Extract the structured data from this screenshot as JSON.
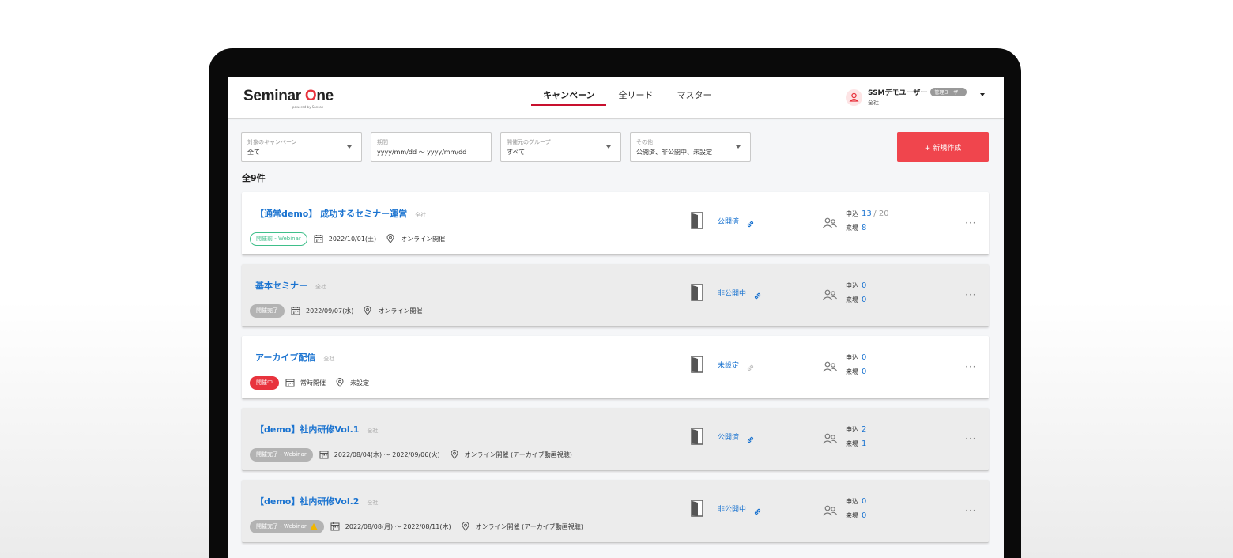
{
  "header": {
    "logo_main": "Seminar ",
    "logo_accent": "O",
    "logo_rest": "ne",
    "logo_sub": "powered by Sansan",
    "nav": [
      {
        "label": "キャンペーン",
        "active": true
      },
      {
        "label": "全リード",
        "active": false
      },
      {
        "label": "マスター",
        "active": false
      }
    ],
    "user": {
      "name": "SSMデモユーザー",
      "role": "管理ユーザー",
      "company": "全社"
    }
  },
  "filters": [
    {
      "label": "対象のキャンペーン",
      "value": "全て",
      "has_dropdown": true
    },
    {
      "label": "期間",
      "value": "yyyy/mm/dd 〜 yyyy/mm/dd",
      "has_dropdown": false
    },
    {
      "label": "開催元のグループ",
      "value": "すべて",
      "has_dropdown": true
    },
    {
      "label": "その他",
      "value": "公開済、非公開中、未設定",
      "has_dropdown": true
    }
  ],
  "create_button": "+ 新規作成",
  "total": "全9件",
  "campaigns": [
    {
      "title": "【通常demo】 成功するセミナー運営",
      "tag": "全社",
      "status": "開催前 - Webinar",
      "status_style": "green",
      "warning": false,
      "date": "2022/10/01(土)",
      "location": "オンライン開催",
      "publish": "公開済",
      "link_active": true,
      "applied_label": "申込",
      "applied": "13",
      "capacity": "/ 20",
      "attended_label": "来場",
      "attended": "8",
      "bg": "white"
    },
    {
      "title": "基本セミナー",
      "tag": "全社",
      "status": "開催完了",
      "status_style": "grayb",
      "warning": false,
      "date": "2022/09/07(水)",
      "location": "オンライン開催",
      "publish": "非公開中",
      "link_active": true,
      "applied_label": "申込",
      "applied": "0",
      "capacity": "",
      "attended_label": "来場",
      "attended": "0",
      "bg": "gray"
    },
    {
      "title": "アーカイブ配信",
      "tag": "全社",
      "status": "開催中",
      "status_style": "red",
      "warning": false,
      "date": "常時開催",
      "location": "未設定",
      "publish": "未設定",
      "link_active": false,
      "applied_label": "申込",
      "applied": "0",
      "capacity": "",
      "attended_label": "来場",
      "attended": "0",
      "bg": "white"
    },
    {
      "title": "【demo】社内研修Vol.1",
      "tag": "全社",
      "status": "開催完了 - Webinar",
      "status_style": "grayb",
      "warning": false,
      "date": "2022/08/04(木) 〜 2022/09/06(火)",
      "location": "オンライン開催 (アーカイブ動画視聴)",
      "publish": "公開済",
      "link_active": true,
      "applied_label": "申込",
      "applied": "2",
      "capacity": "",
      "attended_label": "来場",
      "attended": "1",
      "bg": "gray"
    },
    {
      "title": "【demo】社内研修Vol.2",
      "tag": "全社",
      "status": "開催完了 - Webinar",
      "status_style": "grayb",
      "warning": true,
      "date": "2022/08/08(月) 〜 2022/08/11(木)",
      "location": "オンライン開催 (アーカイブ動画視聴)",
      "publish": "非公開中",
      "link_active": true,
      "applied_label": "申込",
      "applied": "0",
      "capacity": "",
      "attended_label": "来場",
      "attended": "0",
      "bg": "gray"
    }
  ],
  "colors": {
    "accent_red": "#e8333d",
    "link_blue": "#1a73d0",
    "status_green": "#3fbf8a"
  }
}
